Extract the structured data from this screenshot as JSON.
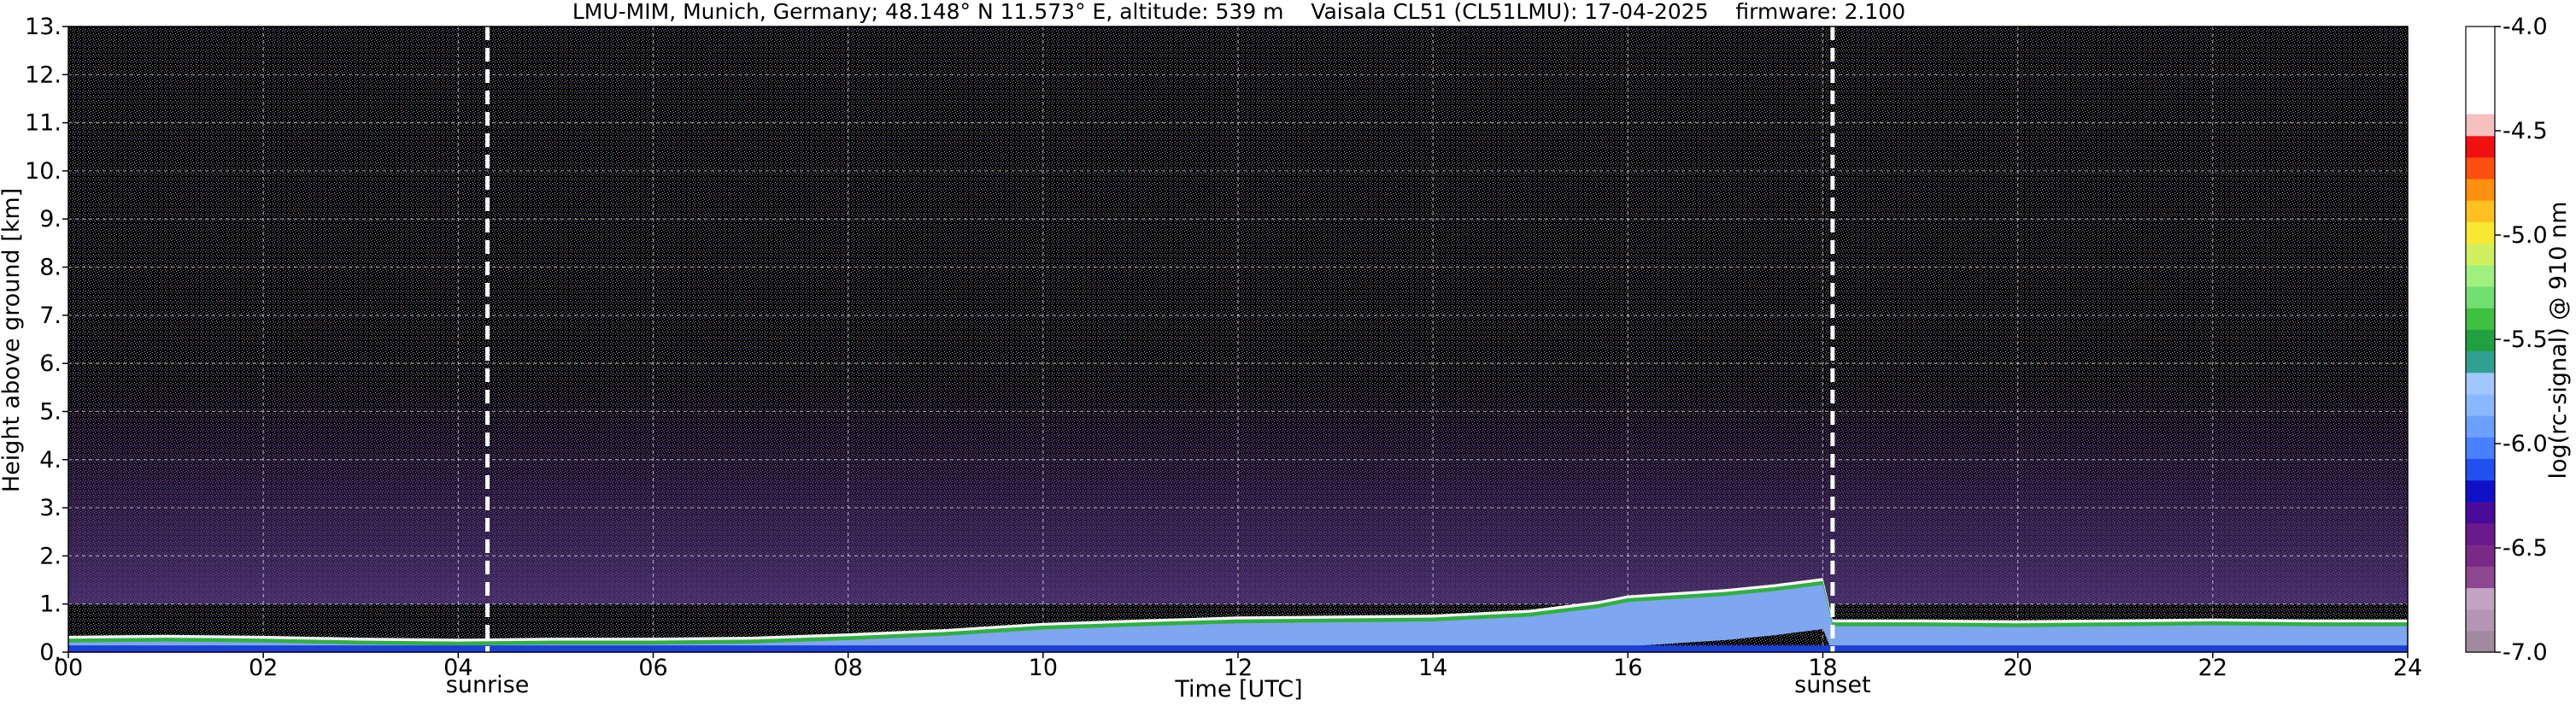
{
  "chart_data": {
    "type": "heatmap",
    "title": "LMU-MIM, Munich, Germany; 48.148° N 11.573° E, altitude: 539 m    Vaisala CL51 (CL51LMU): 17-04-2025    firmware: 2.100",
    "xlabel": "Time [UTC]",
    "ylabel": "Height above ground [km]",
    "xlim": [
      0,
      24
    ],
    "ylim": [
      0,
      13
    ],
    "x_ticks": [
      "00",
      "02",
      "04",
      "06",
      "08",
      "10",
      "12",
      "14",
      "16",
      "18",
      "20",
      "22",
      "24"
    ],
    "y_ticks": [
      "0.",
      "1.",
      "2.",
      "3.",
      "4.",
      "5.",
      "6.",
      "7.",
      "8.",
      "9.",
      "10.",
      "11.",
      "12.",
      "13."
    ],
    "grid": true,
    "colorbar": {
      "label": "log(rc-signal) @ 910 nm",
      "range": [
        -7.0,
        -4.0
      ],
      "ticks": [
        "-4.0",
        "-4.5",
        "-5.0",
        "-5.5",
        "-6.0",
        "-6.5",
        "-7.0"
      ],
      "colors": [
        "#a08aa0",
        "#b496b4",
        "#c2a4c2",
        "#8e468e",
        "#7a2a86",
        "#6a1a8a",
        "#4a0a9a",
        "#1010c8",
        "#2050f0",
        "#4880ff",
        "#6aa0ff",
        "#8ab8ff",
        "#a0c8ff",
        "#30a090",
        "#20a040",
        "#40c040",
        "#70e070",
        "#a0f080",
        "#d0f060",
        "#f8e830",
        "#ffc020",
        "#ff9010",
        "#ff5010",
        "#f01010",
        "#f4c0c0",
        "#ffffff"
      ]
    },
    "markers": [
      {
        "label": "sunrise",
        "x": 4.3
      },
      {
        "label": "sunset",
        "x": 18.1
      }
    ],
    "series": [
      {
        "values": [
          [
            0.0,
            0.28
          ],
          [
            1.0,
            0.3
          ],
          [
            2.0,
            0.28
          ],
          [
            3.0,
            0.24
          ],
          [
            4.0,
            0.22
          ],
          [
            5.0,
            0.24
          ],
          [
            6.0,
            0.24
          ],
          [
            7.0,
            0.26
          ],
          [
            8.0,
            0.33
          ],
          [
            9.0,
            0.42
          ],
          [
            10.0,
            0.55
          ],
          [
            11.0,
            0.62
          ],
          [
            12.0,
            0.68
          ],
          [
            13.0,
            0.7
          ],
          [
            14.0,
            0.72
          ],
          [
            15.0,
            0.82
          ],
          [
            15.7,
            1.0
          ],
          [
            16.0,
            1.12
          ],
          [
            17.0,
            1.25
          ],
          [
            17.5,
            1.35
          ],
          [
            18.0,
            1.48
          ],
          [
            18.1,
            0.62
          ],
          [
            19.0,
            0.62
          ],
          [
            20.0,
            0.6
          ],
          [
            21.0,
            0.62
          ],
          [
            22.0,
            0.64
          ],
          [
            23.0,
            0.62
          ],
          [
            24.0,
            0.62
          ]
        ]
      }
    ]
  }
}
